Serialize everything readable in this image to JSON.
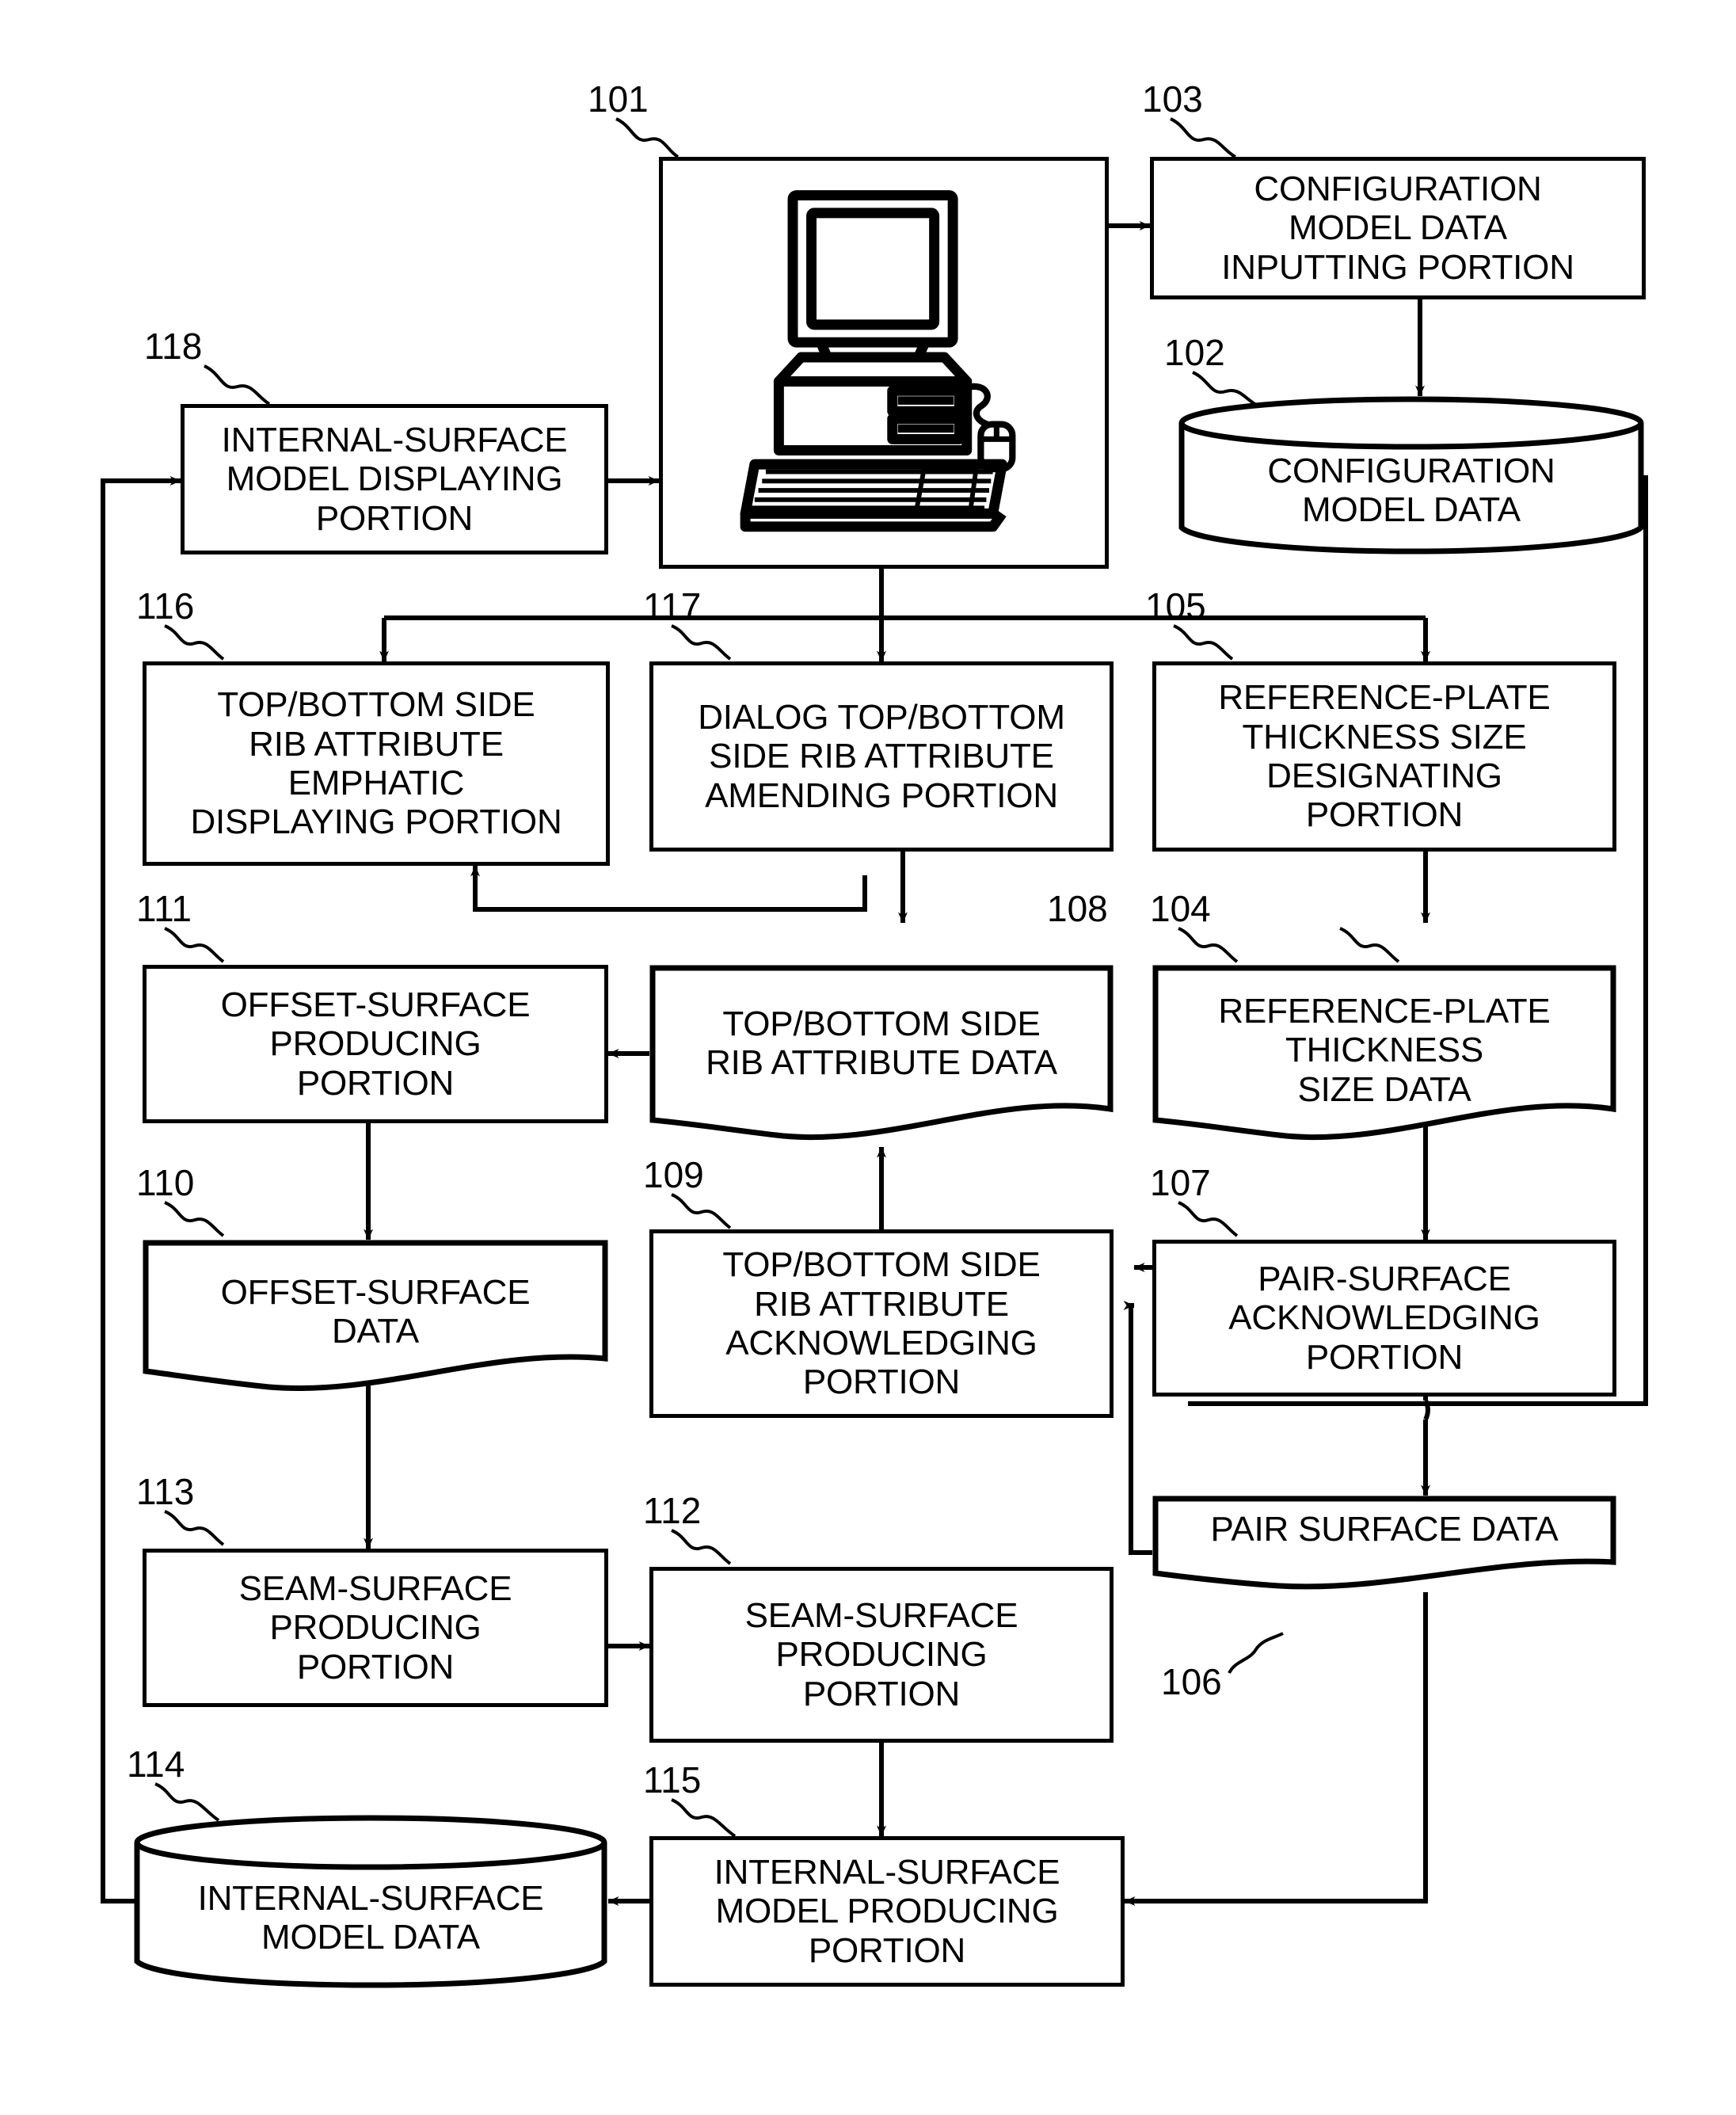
{
  "figure": {
    "title": "Internal-surface model producing system block diagram",
    "line_color": "#000000",
    "background": "#ffffff"
  },
  "nodes": [
    {
      "id": "101",
      "ref": "101",
      "shape": "box-illustration",
      "label": "",
      "icon": "desktop-computer-icon"
    },
    {
      "id": "103",
      "ref": "103",
      "shape": "box",
      "label": "CONFIGURATION\nMODEL DATA\nINPUTTING PORTION"
    },
    {
      "id": "102",
      "ref": "102",
      "shape": "cylinder",
      "label": "CONFIGURATION\nMODEL DATA"
    },
    {
      "id": "118",
      "ref": "118",
      "shape": "box",
      "label": "INTERNAL-SURFACE\nMODEL DISPLAYING\nPORTION"
    },
    {
      "id": "116",
      "ref": "116",
      "shape": "box",
      "label": "TOP/BOTTOM SIDE\nRIB ATTRIBUTE\nEMPHATIC\nDISPLAYING PORTION"
    },
    {
      "id": "117",
      "ref": "117",
      "shape": "box",
      "label": "DIALOG TOP/BOTTOM\nSIDE RIB ATTRIBUTE\nAMENDING PORTION"
    },
    {
      "id": "105",
      "ref": "105",
      "shape": "box",
      "label": "REFERENCE-PLATE\nTHICKNESS SIZE\nDESIGNATING\nPORTION"
    },
    {
      "id": "111",
      "ref": "111",
      "shape": "box",
      "label": "OFFSET-SURFACE\nPRODUCING\nPORTION"
    },
    {
      "id": "108",
      "ref": "108",
      "shape": "document",
      "label": "TOP/BOTTOM SIDE\nRIB ATTRIBUTE DATA"
    },
    {
      "id": "104",
      "ref": "104",
      "shape": "document",
      "label": "REFERENCE-PLATE\nTHICKNESS\nSIZE DATA"
    },
    {
      "id": "110",
      "ref": "110",
      "shape": "document",
      "label": "OFFSET-SURFACE\nDATA"
    },
    {
      "id": "109",
      "ref": "109",
      "shape": "box",
      "label": "TOP/BOTTOM SIDE\nRIB ATTRIBUTE\nACKNOWLEDGING\nPORTION"
    },
    {
      "id": "107",
      "ref": "107",
      "shape": "box",
      "label": "PAIR-SURFACE\nACKNOWLEDGING\nPORTION"
    },
    {
      "id": "106",
      "ref": "106",
      "shape": "document",
      "label": "PAIR SURFACE DATA"
    },
    {
      "id": "113",
      "ref": "113",
      "shape": "box",
      "label": "SEAM-SURFACE\nPRODUCING\nPORTION"
    },
    {
      "id": "112",
      "ref": "112",
      "shape": "box",
      "label": "SEAM-SURFACE\nPRODUCING\nPORTION"
    },
    {
      "id": "114",
      "ref": "114",
      "shape": "cylinder",
      "label": "INTERNAL-SURFACE\nMODEL DATA"
    },
    {
      "id": "115",
      "ref": "115",
      "shape": "box",
      "label": "INTERNAL-SURFACE\nMODEL PRODUCING\nPORTION"
    }
  ],
  "text": {
    "n101": "",
    "n103": "CONFIGURATION\nMODEL DATA\nINPUTTING PORTION",
    "n102": "CONFIGURATION\nMODEL DATA",
    "n118": "INTERNAL-SURFACE\nMODEL DISPLAYING\nPORTION",
    "n116": "TOP/BOTTOM SIDE\nRIB ATTRIBUTE\nEMPHATIC\nDISPLAYING PORTION",
    "n117": "DIALOG TOP/BOTTOM\nSIDE RIB ATTRIBUTE\nAMENDING PORTION",
    "n105": "REFERENCE-PLATE\nTHICKNESS SIZE\nDESIGNATING\nPORTION",
    "n111": "OFFSET-SURFACE\nPRODUCING\nPORTION",
    "n108": "TOP/BOTTOM SIDE\nRIB ATTRIBUTE DATA",
    "n104": "REFERENCE-PLATE\nTHICKNESS\nSIZE DATA",
    "n110": "OFFSET-SURFACE\nDATA",
    "n109": "TOP/BOTTOM SIDE\nRIB ATTRIBUTE\nACKNOWLEDGING\nPORTION",
    "n107": "PAIR-SURFACE\nACKNOWLEDGING\nPORTION",
    "n106": "PAIR SURFACE DATA",
    "n113": "SEAM-SURFACE\nPRODUCING\nPORTION",
    "n112": "SEAM-SURFACE\nPRODUCING\nPORTION",
    "n114": "INTERNAL-SURFACE\nMODEL DATA",
    "n115": "INTERNAL-SURFACE\nMODEL PRODUCING\nPORTION"
  },
  "refnums": {
    "r101": "101",
    "r103": "103",
    "r102": "102",
    "r118": "118",
    "r116": "116",
    "r117": "117",
    "r105": "105",
    "r111": "111",
    "r108": "108",
    "r104": "104",
    "r110": "110",
    "r109": "109",
    "r107": "107",
    "r106": "106",
    "r113": "113",
    "r112": "112",
    "r114": "114",
    "r115": "115"
  }
}
